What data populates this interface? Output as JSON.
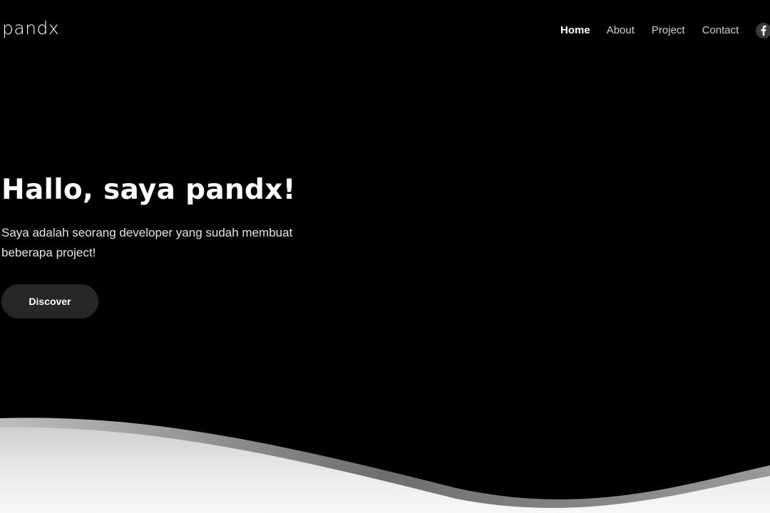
{
  "header": {
    "logo": "pandx",
    "nav": [
      {
        "label": "Home",
        "active": true
      },
      {
        "label": "About",
        "active": false
      },
      {
        "label": "Project",
        "active": false
      },
      {
        "label": "Contact",
        "active": false
      }
    ],
    "social_icon": "facebook-icon"
  },
  "hero": {
    "title": "Hallo, saya pandx!",
    "subtitle": "Saya adalah seorang developer yang sudah membuat beberapa project!",
    "cta_label": "Discover"
  },
  "colors": {
    "background": "#000000",
    "text": "#ffffff",
    "button_bg": "#262626",
    "wave_light": "#ffffff",
    "wave_shadow": "#8a8a8a"
  }
}
